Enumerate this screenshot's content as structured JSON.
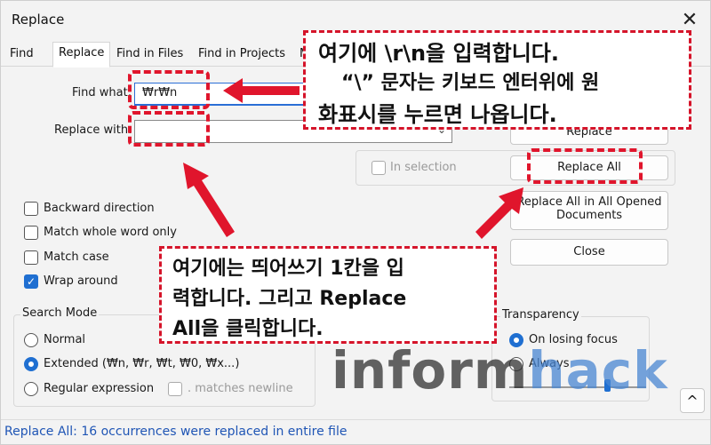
{
  "window": {
    "title": "Replace",
    "close_glyph": "✕"
  },
  "tabs": [
    {
      "label": "Find"
    },
    {
      "label": "Replace"
    },
    {
      "label": "Find in Files"
    },
    {
      "label": "Find in Projects"
    },
    {
      "label": "M"
    }
  ],
  "form": {
    "find_label": "Find what:",
    "find_value": "₩r₩n",
    "replace_label": "Replace with:",
    "replace_value": "",
    "dropdown_arrow": "⌄"
  },
  "buttons": {
    "replace": "Replace",
    "replace_all": "Replace All",
    "replace_all_opened_1": "Replace All in All Opened",
    "replace_all_opened_2": "Documents",
    "close": "Close",
    "collapse": "^"
  },
  "in_selection": {
    "label": "In selection",
    "checked": false
  },
  "options": [
    {
      "label": "Backward direction",
      "checked": false
    },
    {
      "label": "Match whole word only",
      "checked": false
    },
    {
      "label": "Match case",
      "checked": false
    },
    {
      "label": "Wrap around",
      "checked": true
    }
  ],
  "search_mode": {
    "title": "Search Mode",
    "modes": [
      {
        "label": "Normal",
        "selected": false
      },
      {
        "label": "Extended (₩n, ₩r, ₩t, ₩0, ₩x...)",
        "selected": true
      },
      {
        "label": "Regular expression",
        "selected": false
      }
    ],
    "matches_newline": ". matches newline"
  },
  "transparency": {
    "title": "Transparency",
    "options": [
      {
        "label": "On losing focus",
        "selected": true
      },
      {
        "label": "Always",
        "selected": false
      }
    ]
  },
  "status": {
    "text": "Replace All: 16 occurrences were replaced in entire file"
  },
  "annotations": {
    "top": {
      "line1": "여기에 \\r\\n을 입력합니다.",
      "line2": "“\\” 문자는 키보드 엔터위에 원",
      "line3": "화표시를 누르면 나옵니다."
    },
    "bottom": {
      "line1": "여기에는 띄어쓰기 1칸을 입",
      "line2": "력합니다. 그리고 Replace",
      "line3": "All을 클릭합니다."
    }
  },
  "watermark": {
    "part1": "inform",
    "part2": "hack"
  },
  "colors": {
    "annotation_red": "#e0152c",
    "accent_blue": "#1f6fd1",
    "status_blue": "#1f55b5"
  }
}
